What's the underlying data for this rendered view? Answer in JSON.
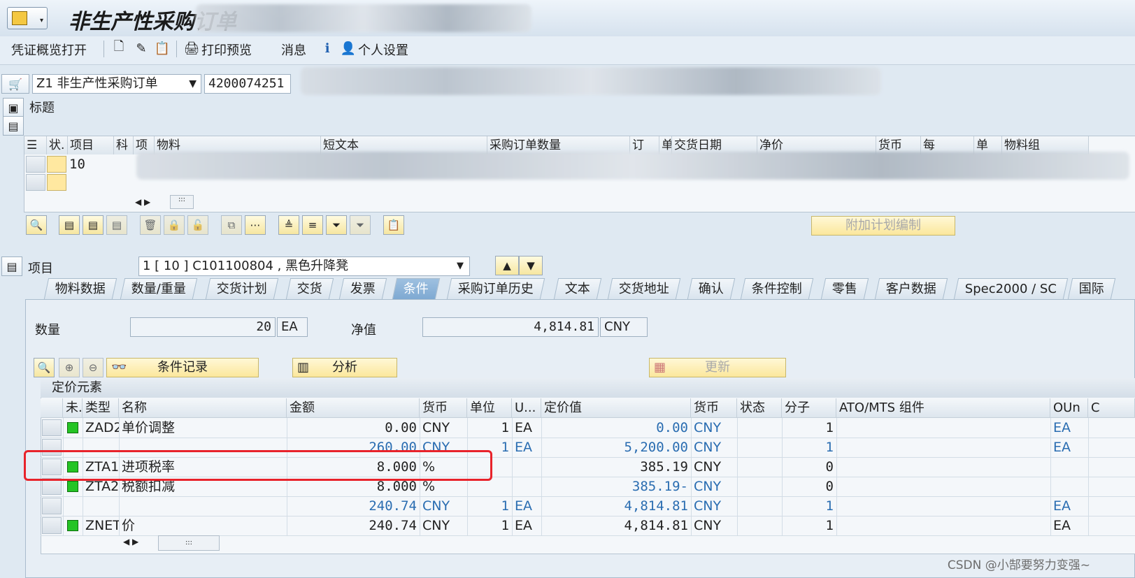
{
  "window": {
    "title": "非生产性采购订单"
  },
  "toolbar": {
    "overview_label": "凭证概览打开",
    "print_preview_label": "打印预览",
    "messages_label": "消息",
    "personal_settings_label": "个人设置"
  },
  "header": {
    "doc_type": "Z1 非生产性采购订单",
    "po_number": "4200074251",
    "header_label": "标题"
  },
  "items_grid": {
    "columns": [
      "状.",
      "项目",
      "科",
      "项",
      "物料",
      "短文本",
      "采购订单数量",
      "订",
      "单",
      "交货日期",
      "净价",
      "货币",
      "每",
      "单",
      "物料组"
    ],
    "rows": [
      {
        "item": "10"
      }
    ]
  },
  "item_actions": {
    "extra_plan_label": "附加计划编制"
  },
  "item_detail": {
    "label": "项目",
    "selected_item": "1 [ 10 ] C101100804 , 黑色升降凳"
  },
  "tabs": [
    {
      "label": "物料数据"
    },
    {
      "label": "数量/重量"
    },
    {
      "label": "交货计划"
    },
    {
      "label": "交货"
    },
    {
      "label": "发票"
    },
    {
      "label": "条件",
      "active": true
    },
    {
      "label": "采购订单历史"
    },
    {
      "label": "文本"
    },
    {
      "label": "交货地址"
    },
    {
      "label": "确认"
    },
    {
      "label": "条件控制"
    },
    {
      "label": "零售"
    },
    {
      "label": "客户数据"
    },
    {
      "label": "Spec2000 / SC"
    },
    {
      "label": "国际"
    }
  ],
  "conditions": {
    "quantity_label": "数量",
    "quantity_value": "20",
    "quantity_unit": "EA",
    "net_value_label": "净值",
    "net_value": "4,814.81",
    "net_currency": "CNY",
    "cond_record_label": "条件记录",
    "analysis_label": "分析",
    "update_label": "更新",
    "pricing_title": "定价元素",
    "columns": {
      "inactive": "未.",
      "type": "类型",
      "name": "名称",
      "amount": "金额",
      "currency": "货币",
      "per": "单位",
      "uom": "U...",
      "cond_value": "定价值",
      "cond_currency": "货币",
      "status": "状态",
      "numerator": "分子",
      "atomts": "ATO/MTS 组件",
      "oun": "OUn"
    },
    "rows": [
      {
        "status": true,
        "type": "ZAD2",
        "name": "单价调整",
        "amount": "0.00",
        "currency": "CNY",
        "per": "1",
        "uom": "EA",
        "value": "0.00",
        "vcur": "CNY",
        "num": "1",
        "oun": "EA",
        "blue_value": true
      },
      {
        "status": false,
        "type": "",
        "name": "",
        "amount": "260.00",
        "currency": "CNY",
        "per": "1",
        "uom": "EA",
        "value": "5,200.00",
        "vcur": "CNY",
        "num": "1",
        "oun": "EA",
        "blue_all": true
      },
      {
        "status": true,
        "type": "ZTA1",
        "name": "进项税率",
        "amount": "8.000",
        "currency": "%",
        "per": "",
        "uom": "",
        "value": "385.19",
        "vcur": "CNY",
        "num": "0",
        "oun": ""
      },
      {
        "status": true,
        "type": "ZTA2",
        "name": "税额扣减",
        "amount": "8.000",
        "currency": "%",
        "per": "",
        "uom": "",
        "value": "385.19-",
        "vcur": "CNY",
        "num": "0",
        "oun": "",
        "blue_value": true
      },
      {
        "status": false,
        "type": "",
        "name": "",
        "amount": "240.74",
        "currency": "CNY",
        "per": "1",
        "uom": "EA",
        "value": "4,814.81",
        "vcur": "CNY",
        "num": "1",
        "oun": "EA",
        "blue_all": true
      },
      {
        "status": true,
        "type": "ZNET",
        "name": "价",
        "amount": "240.74",
        "currency": "CNY",
        "per": "1",
        "uom": "EA",
        "value": "4,814.81",
        "vcur": "CNY",
        "num": "1",
        "oun": "EA"
      }
    ]
  },
  "watermark": "CSDN @小郜要努力变强~"
}
